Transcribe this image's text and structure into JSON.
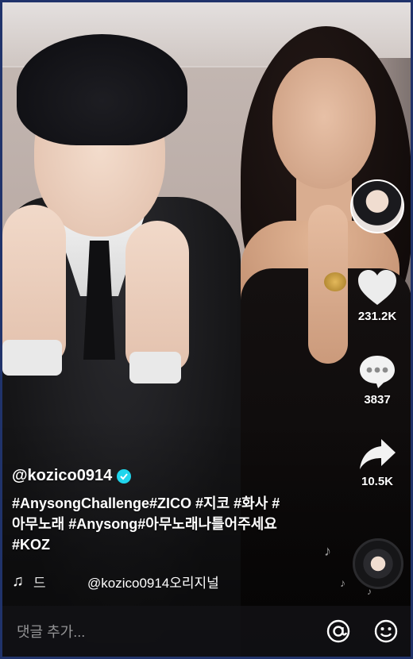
{
  "post": {
    "username": "@kozico0914",
    "description_line1": "#AnysongChallenge#ZICO #지코 #화사 #",
    "description_line2": "아무노래 #Anysong#아무노래나틀어주세요",
    "description_line3": "#KOZ",
    "music_left": "드",
    "music_title": "@kozico0914오리지널"
  },
  "actions": {
    "likes": "231.2K",
    "comments": "3837",
    "shares": "10.5K"
  },
  "comment_bar": {
    "placeholder": "댓글 추가..."
  },
  "icons": [
    "verified-badge-icon",
    "heart-icon",
    "comment-icon",
    "share-icon",
    "music-note-icon",
    "at-mention-icon",
    "emoji-icon"
  ],
  "colors": {
    "verified": "#20d5ec",
    "frame_border": "#20336b"
  }
}
